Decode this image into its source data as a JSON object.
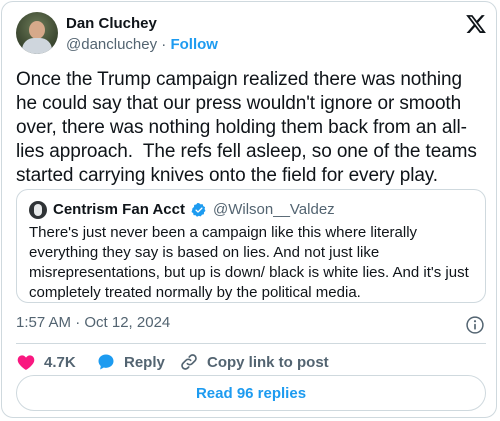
{
  "author": {
    "name": "Dan Cluchey",
    "handle": "@dancluchey",
    "separator": "·",
    "follow_label": "Follow"
  },
  "tweet": {
    "text": "Once the Trump campaign realized there was nothing he could say that our press wouldn't ignore or smooth over, there was nothing holding them back from an all-lies approach.  The refs fell asleep, so one of the teams started carrying knives onto the field for every play."
  },
  "quote": {
    "name": "Centrism Fan Acct",
    "handle": "@Wilson__Valdez",
    "text": "There's just never been a campaign like this where literally everything they say is based on lies. And not just like misrepresentations, but up is down/ black is white lies. And it's just completely treated normally by the political media."
  },
  "timestamp": "1:57 AM · Oct 12, 2024",
  "actions": {
    "like_count": "4.7K",
    "reply_label": "Reply",
    "copy_label": "Copy link to post"
  },
  "replies_button": "Read 96 replies",
  "colors": {
    "accent": "#1d9bf0",
    "like": "#f91880",
    "text": "#0f1419",
    "muted": "#536471",
    "border": "#cfd9de"
  },
  "icons": [
    "x-logo-icon",
    "verified-badge-icon",
    "info-icon",
    "heart-icon",
    "reply-bubble-icon",
    "link-icon"
  ]
}
